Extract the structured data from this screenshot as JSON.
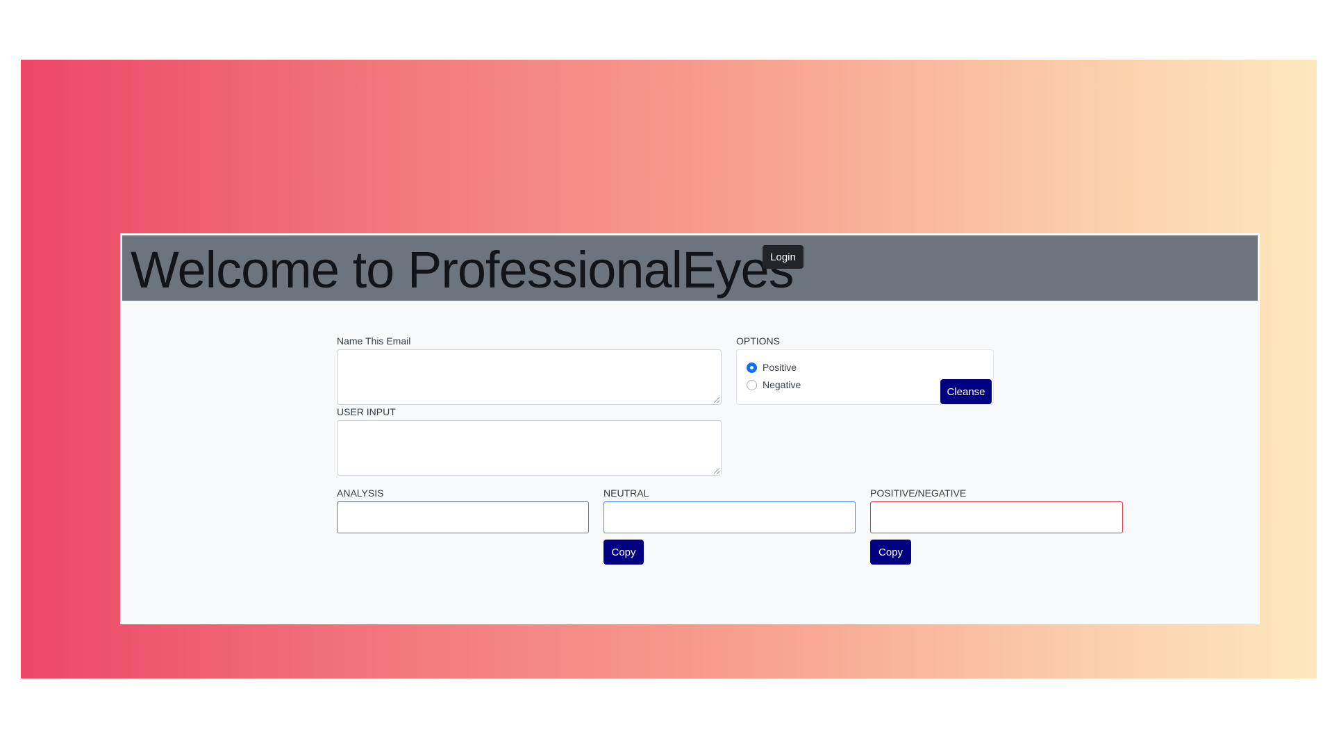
{
  "header": {
    "title": "Welcome to ProfessionalEyes",
    "login_label": "Login"
  },
  "form": {
    "name_email_label": "Name This Email",
    "name_email_value": "",
    "user_input_label": "USER INPUT",
    "user_input_value": "",
    "options_label": "OPTIONS",
    "options": [
      {
        "label": "Positive",
        "checked": true
      },
      {
        "label": "Negative",
        "checked": false
      }
    ],
    "cleanse_label": "Cleanse",
    "analysis_label": "ANALYSIS",
    "analysis_value": "",
    "neutral_label": "NEUTRAL",
    "neutral_value": "",
    "posneg_label": "POSITIVE/NEGATIVE",
    "posneg_value": "",
    "copy_label": "Copy"
  },
  "colors": {
    "header_bg": "#6c757d",
    "login_bg": "#212529",
    "action_button_bg": "#000080",
    "radio_checked": "#0d6efd",
    "neutral_border": "#3d8bfd",
    "posneg_border": "#dc3545",
    "gradient_start": "#ec4766",
    "gradient_end": "#fde8bd"
  }
}
